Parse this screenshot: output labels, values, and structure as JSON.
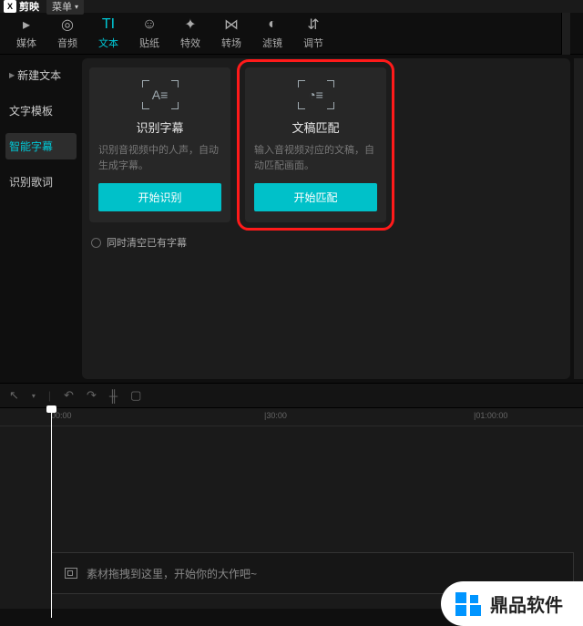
{
  "topbar": {
    "appName": "剪映",
    "menu": "菜单"
  },
  "toolTabs": [
    {
      "icon": "▸",
      "label": "媒体",
      "name": "media"
    },
    {
      "icon": "◎",
      "label": "音频",
      "name": "audio"
    },
    {
      "icon": "TI",
      "label": "文本",
      "name": "text",
      "active": true
    },
    {
      "icon": "☺",
      "label": "贴纸",
      "name": "sticker"
    },
    {
      "icon": "✦",
      "label": "特效",
      "name": "effect"
    },
    {
      "icon": "⋈",
      "label": "转场",
      "name": "transition"
    },
    {
      "icon": "◐",
      "label": "滤镜",
      "name": "filter"
    },
    {
      "icon": "⇵",
      "label": "调节",
      "name": "adjust"
    }
  ],
  "sidebar": [
    {
      "label": "新建文本",
      "name": "new-text",
      "expandable": true
    },
    {
      "label": "文字模板",
      "name": "text-template"
    },
    {
      "label": "智能字幕",
      "name": "smart-caption",
      "active": true
    },
    {
      "label": "识别歌词",
      "name": "lyric-detect"
    }
  ],
  "cards": [
    {
      "name": "recognize-subtitle",
      "icon": "A≡",
      "title": "识别字幕",
      "desc": "识别音视频中的人声，自动生成字幕。",
      "btn": "开始识别",
      "highlight": false
    },
    {
      "name": "script-match",
      "icon": "◔≡",
      "title": "文稿匹配",
      "desc": "输入音视频对应的文稿，自动匹配画面。",
      "btn": "开始匹配",
      "highlight": true
    }
  ],
  "clearOption": "同时清空已有字幕",
  "ruler": [
    {
      "pos": 56,
      "label": "00:00"
    },
    {
      "pos": 290,
      "label": "|30:00"
    },
    {
      "pos": 520,
      "label": "|01:00:00"
    }
  ],
  "timelinePlaceholder": "素材拖拽到这里，开始你的大作吧~",
  "watermark": "鼎品软件"
}
